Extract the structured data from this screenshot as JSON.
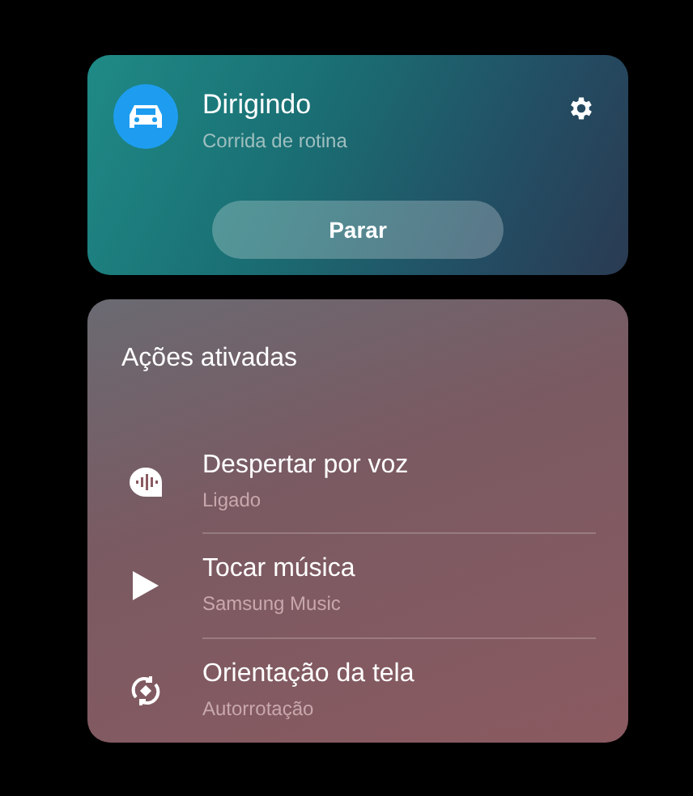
{
  "routine": {
    "title": "Dirigindo",
    "subtitle": "Corrida de rotina",
    "button": "Parar"
  },
  "actions": {
    "heading": "Ações ativadas",
    "items": [
      {
        "kind": "voice",
        "title": "Despertar por voz",
        "subtitle": "Ligado"
      },
      {
        "kind": "play",
        "title": "Tocar música",
        "subtitle": "Samsung Music"
      },
      {
        "kind": "rotate",
        "title": "Orientação da tela",
        "subtitle": "Autorrotação"
      }
    ]
  }
}
